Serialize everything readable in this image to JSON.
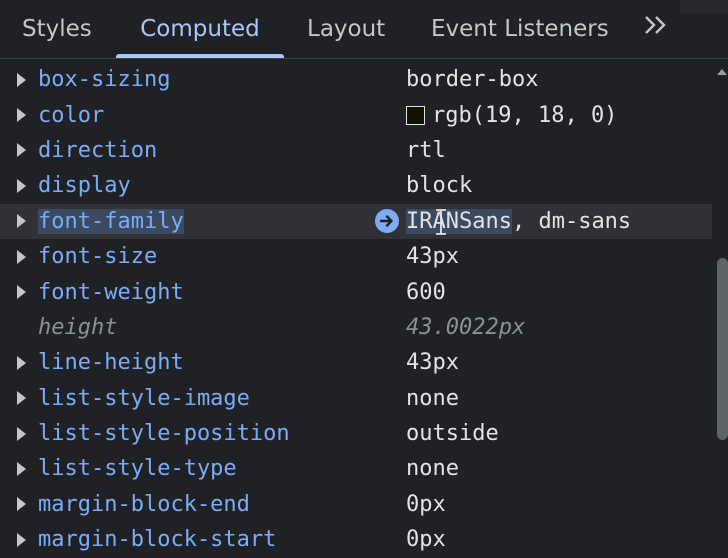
{
  "tabs": [
    {
      "label": "Styles"
    },
    {
      "label": "Computed"
    },
    {
      "label": "Layout"
    },
    {
      "label": "Event Listeners"
    }
  ],
  "more_tabs_icon": "double-chevron-right-icon",
  "properties": [
    {
      "name": "box-sizing",
      "value": "border-box"
    },
    {
      "name": "color",
      "value": "rgb(19, 18, 0)",
      "swatch": "#131200"
    },
    {
      "name": "direction",
      "value": "rtl"
    },
    {
      "name": "display",
      "value": "block"
    },
    {
      "name": "font-family",
      "value_highlight": "IRANSans",
      "value_rest": ", dm-sans",
      "name_highlight": "font-",
      "name_rest": "family"
    },
    {
      "name": "font-size",
      "value": "43px"
    },
    {
      "name": "font-weight",
      "value": "600"
    },
    {
      "name": "height",
      "value": "43.0022px",
      "inherited": true
    },
    {
      "name": "line-height",
      "value": "43px"
    },
    {
      "name": "list-style-image",
      "value": "none"
    },
    {
      "name": "list-style-position",
      "value": "outside"
    },
    {
      "name": "list-style-type",
      "value": "none"
    },
    {
      "name": "margin-block-end",
      "value": "0px"
    },
    {
      "name": "margin-block-start",
      "value": "0px"
    }
  ],
  "colors": {
    "background": "#202124",
    "property_name": "#7cacf8",
    "active_tab": "#a8c7fa"
  }
}
